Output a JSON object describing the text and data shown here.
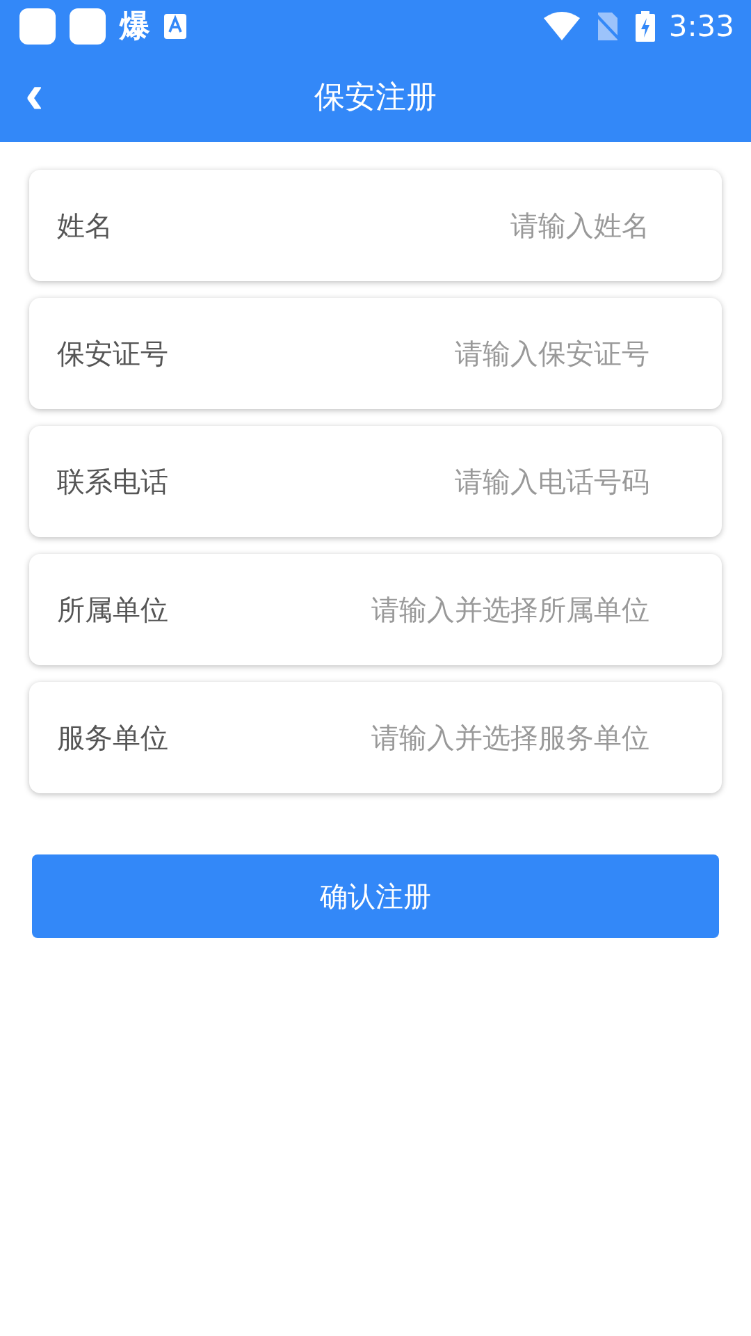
{
  "status_bar": {
    "notification_glyph": "爆",
    "time": "3:33"
  },
  "header": {
    "back": "‹",
    "title": "保安注册"
  },
  "fields": [
    {
      "label": "姓名",
      "placeholder": "请输入姓名"
    },
    {
      "label": "保安证号",
      "placeholder": "请输入保安证号"
    },
    {
      "label": "联系电话",
      "placeholder": "请输入电话号码"
    },
    {
      "label": "所属单位",
      "placeholder": "请输入并选择所属单位"
    },
    {
      "label": "服务单位",
      "placeholder": "请输入并选择服务单位"
    }
  ],
  "submit": "确认注册"
}
